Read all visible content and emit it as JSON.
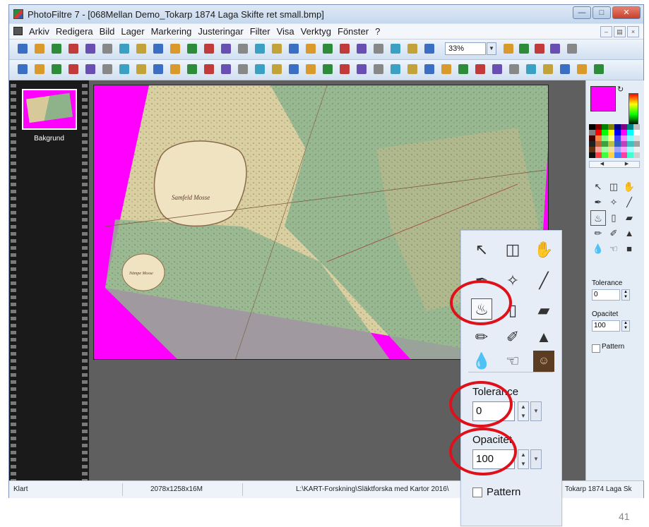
{
  "window": {
    "title": "PhotoFiltre 7 - [068Mellan Demo_Tokarp 1874 Laga Skifte ret small.bmp]"
  },
  "menu": {
    "items": [
      "Arkiv",
      "Redigera",
      "Bild",
      "Lager",
      "Markering",
      "Justeringar",
      "Filter",
      "Visa",
      "Verktyg",
      "Fönster",
      "?"
    ]
  },
  "toolbar": {
    "zoom_value": "33%"
  },
  "layers": {
    "items": [
      {
        "label": "Bakgrund"
      }
    ]
  },
  "tool_options": {
    "tolerance_label": "Tolerance",
    "tolerance_value": "0",
    "opacity_label": "Opacitet",
    "opacity_value": "100",
    "pattern_label": "Pattern"
  },
  "statusbar": {
    "status": "Klart",
    "image_info": "2078x1258x16M",
    "path": "L:\\KART-Forskning\\Släktforska med Kartor 2016\\",
    "filename_tail": "Tokarp 1874 Laga Sk"
  },
  "map_labels": {
    "lake_1": "Samfeld Mosse",
    "lake_2": "Nämpe Mosse"
  },
  "colors": {
    "foreground": "#ff00ff",
    "background": "#ffffff",
    "highlight": "#e0101a"
  },
  "slide": {
    "page_number": "41"
  }
}
